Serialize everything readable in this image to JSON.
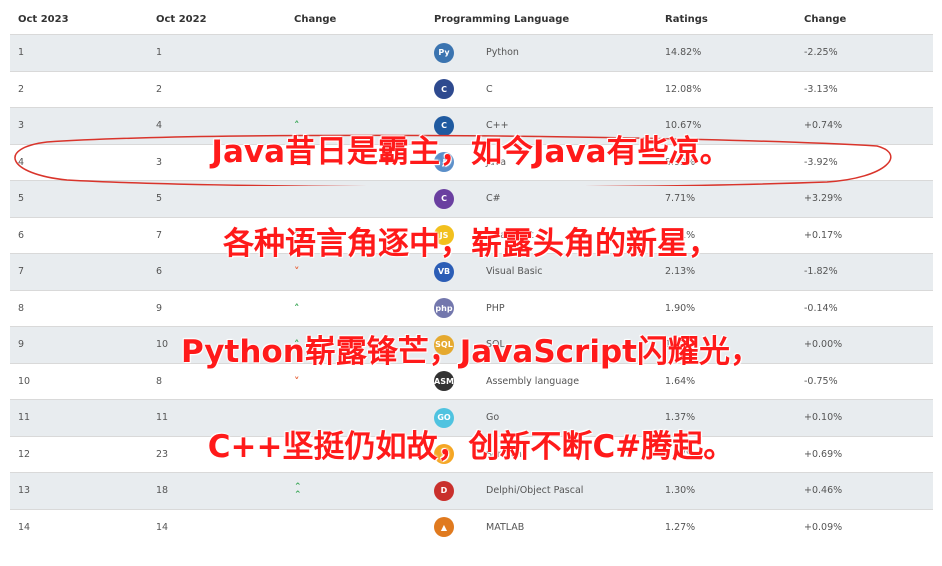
{
  "headers": [
    "Oct 2023",
    "Oct 2022",
    "Change",
    "Programming Language",
    "Ratings",
    "Change"
  ],
  "rows": [
    {
      "now": "1",
      "prev": "1",
      "arrow": "",
      "lang": "Python",
      "rating": "14.82%",
      "change": "-2.25%",
      "icon": "python-icon",
      "icon_color": "#3b74b0",
      "icon_text": "Py"
    },
    {
      "now": "2",
      "prev": "2",
      "arrow": "",
      "lang": "C",
      "rating": "12.08%",
      "change": "-3.13%",
      "icon": "c-icon",
      "icon_color": "#2e4a8f",
      "icon_text": "C"
    },
    {
      "now": "3",
      "prev": "4",
      "arrow": "up",
      "lang": "C++",
      "rating": "10.67%",
      "change": "+0.74%",
      "icon": "cpp-icon",
      "icon_color": "#1f5aa0",
      "icon_text": "C"
    },
    {
      "now": "4",
      "prev": "3",
      "arrow": "down",
      "lang": "Java",
      "rating": "8.92%",
      "change": "-3.92%",
      "icon": "java-icon",
      "icon_color": "#5b8fc9",
      "icon_text": "J"
    },
    {
      "now": "5",
      "prev": "5",
      "arrow": "",
      "lang": "C#",
      "rating": "7.71%",
      "change": "+3.29%",
      "icon": "csharp-icon",
      "icon_color": "#6a3fa0",
      "icon_text": "C"
    },
    {
      "now": "6",
      "prev": "7",
      "arrow": "up",
      "lang": "JavaScript",
      "rating": "2.91%",
      "change": "+0.17%",
      "icon": "javascript-icon",
      "icon_color": "#f2c01e",
      "icon_text": "JS"
    },
    {
      "now": "7",
      "prev": "6",
      "arrow": "down",
      "lang": "Visual Basic",
      "rating": "2.13%",
      "change": "-1.82%",
      "icon": "visual-basic-icon",
      "icon_color": "#2b5db6",
      "icon_text": "VB"
    },
    {
      "now": "8",
      "prev": "9",
      "arrow": "up",
      "lang": "PHP",
      "rating": "1.90%",
      "change": "-0.14%",
      "icon": "php-icon",
      "icon_color": "#7377ad",
      "icon_text": "php"
    },
    {
      "now": "9",
      "prev": "10",
      "arrow": "up",
      "lang": "SQL",
      "rating": "1.78%",
      "change": "+0.00%",
      "icon": "sql-icon",
      "icon_color": "#e5a92f",
      "icon_text": "SQL"
    },
    {
      "now": "10",
      "prev": "8",
      "arrow": "down",
      "lang": "Assembly language",
      "rating": "1.64%",
      "change": "-0.75%",
      "icon": "assembly-icon",
      "icon_color": "#333333",
      "icon_text": "ASM"
    },
    {
      "now": "11",
      "prev": "11",
      "arrow": "",
      "lang": "Go",
      "rating": "1.37%",
      "change": "+0.10%",
      "icon": "go-icon",
      "icon_color": "#4fc3e0",
      "icon_text": "GO"
    },
    {
      "now": "12",
      "prev": "23",
      "arrow": "upup",
      "lang": "Scratch",
      "rating": "1.37%",
      "change": "+0.69%",
      "icon": "scratch-icon",
      "icon_color": "#f5a623",
      "icon_text": "S"
    },
    {
      "now": "13",
      "prev": "18",
      "arrow": "upup",
      "lang": "Delphi/Object Pascal",
      "rating": "1.30%",
      "change": "+0.46%",
      "icon": "delphi-icon",
      "icon_color": "#c9302c",
      "icon_text": "D"
    },
    {
      "now": "14",
      "prev": "14",
      "arrow": "",
      "lang": "MATLAB",
      "rating": "1.27%",
      "change": "+0.09%",
      "icon": "matlab-icon",
      "icon_color": "#e07a1f",
      "icon_text": "▲"
    }
  ],
  "overlay_lines": [
    "Java昔日是霸主，如今Java有些凉。",
    "各种语言角逐中，崭露头角的新星，",
    "Python崭露锋芒，JavaScript闪耀光，",
    "C++坚挺仍如故，创新不断C#腾起。"
  ],
  "colors": {
    "arrow_up": "#3aa757",
    "arrow_down": "#e8663d",
    "overlay_text": "#ff1a1a",
    "ellipse": "#d9342b"
  }
}
